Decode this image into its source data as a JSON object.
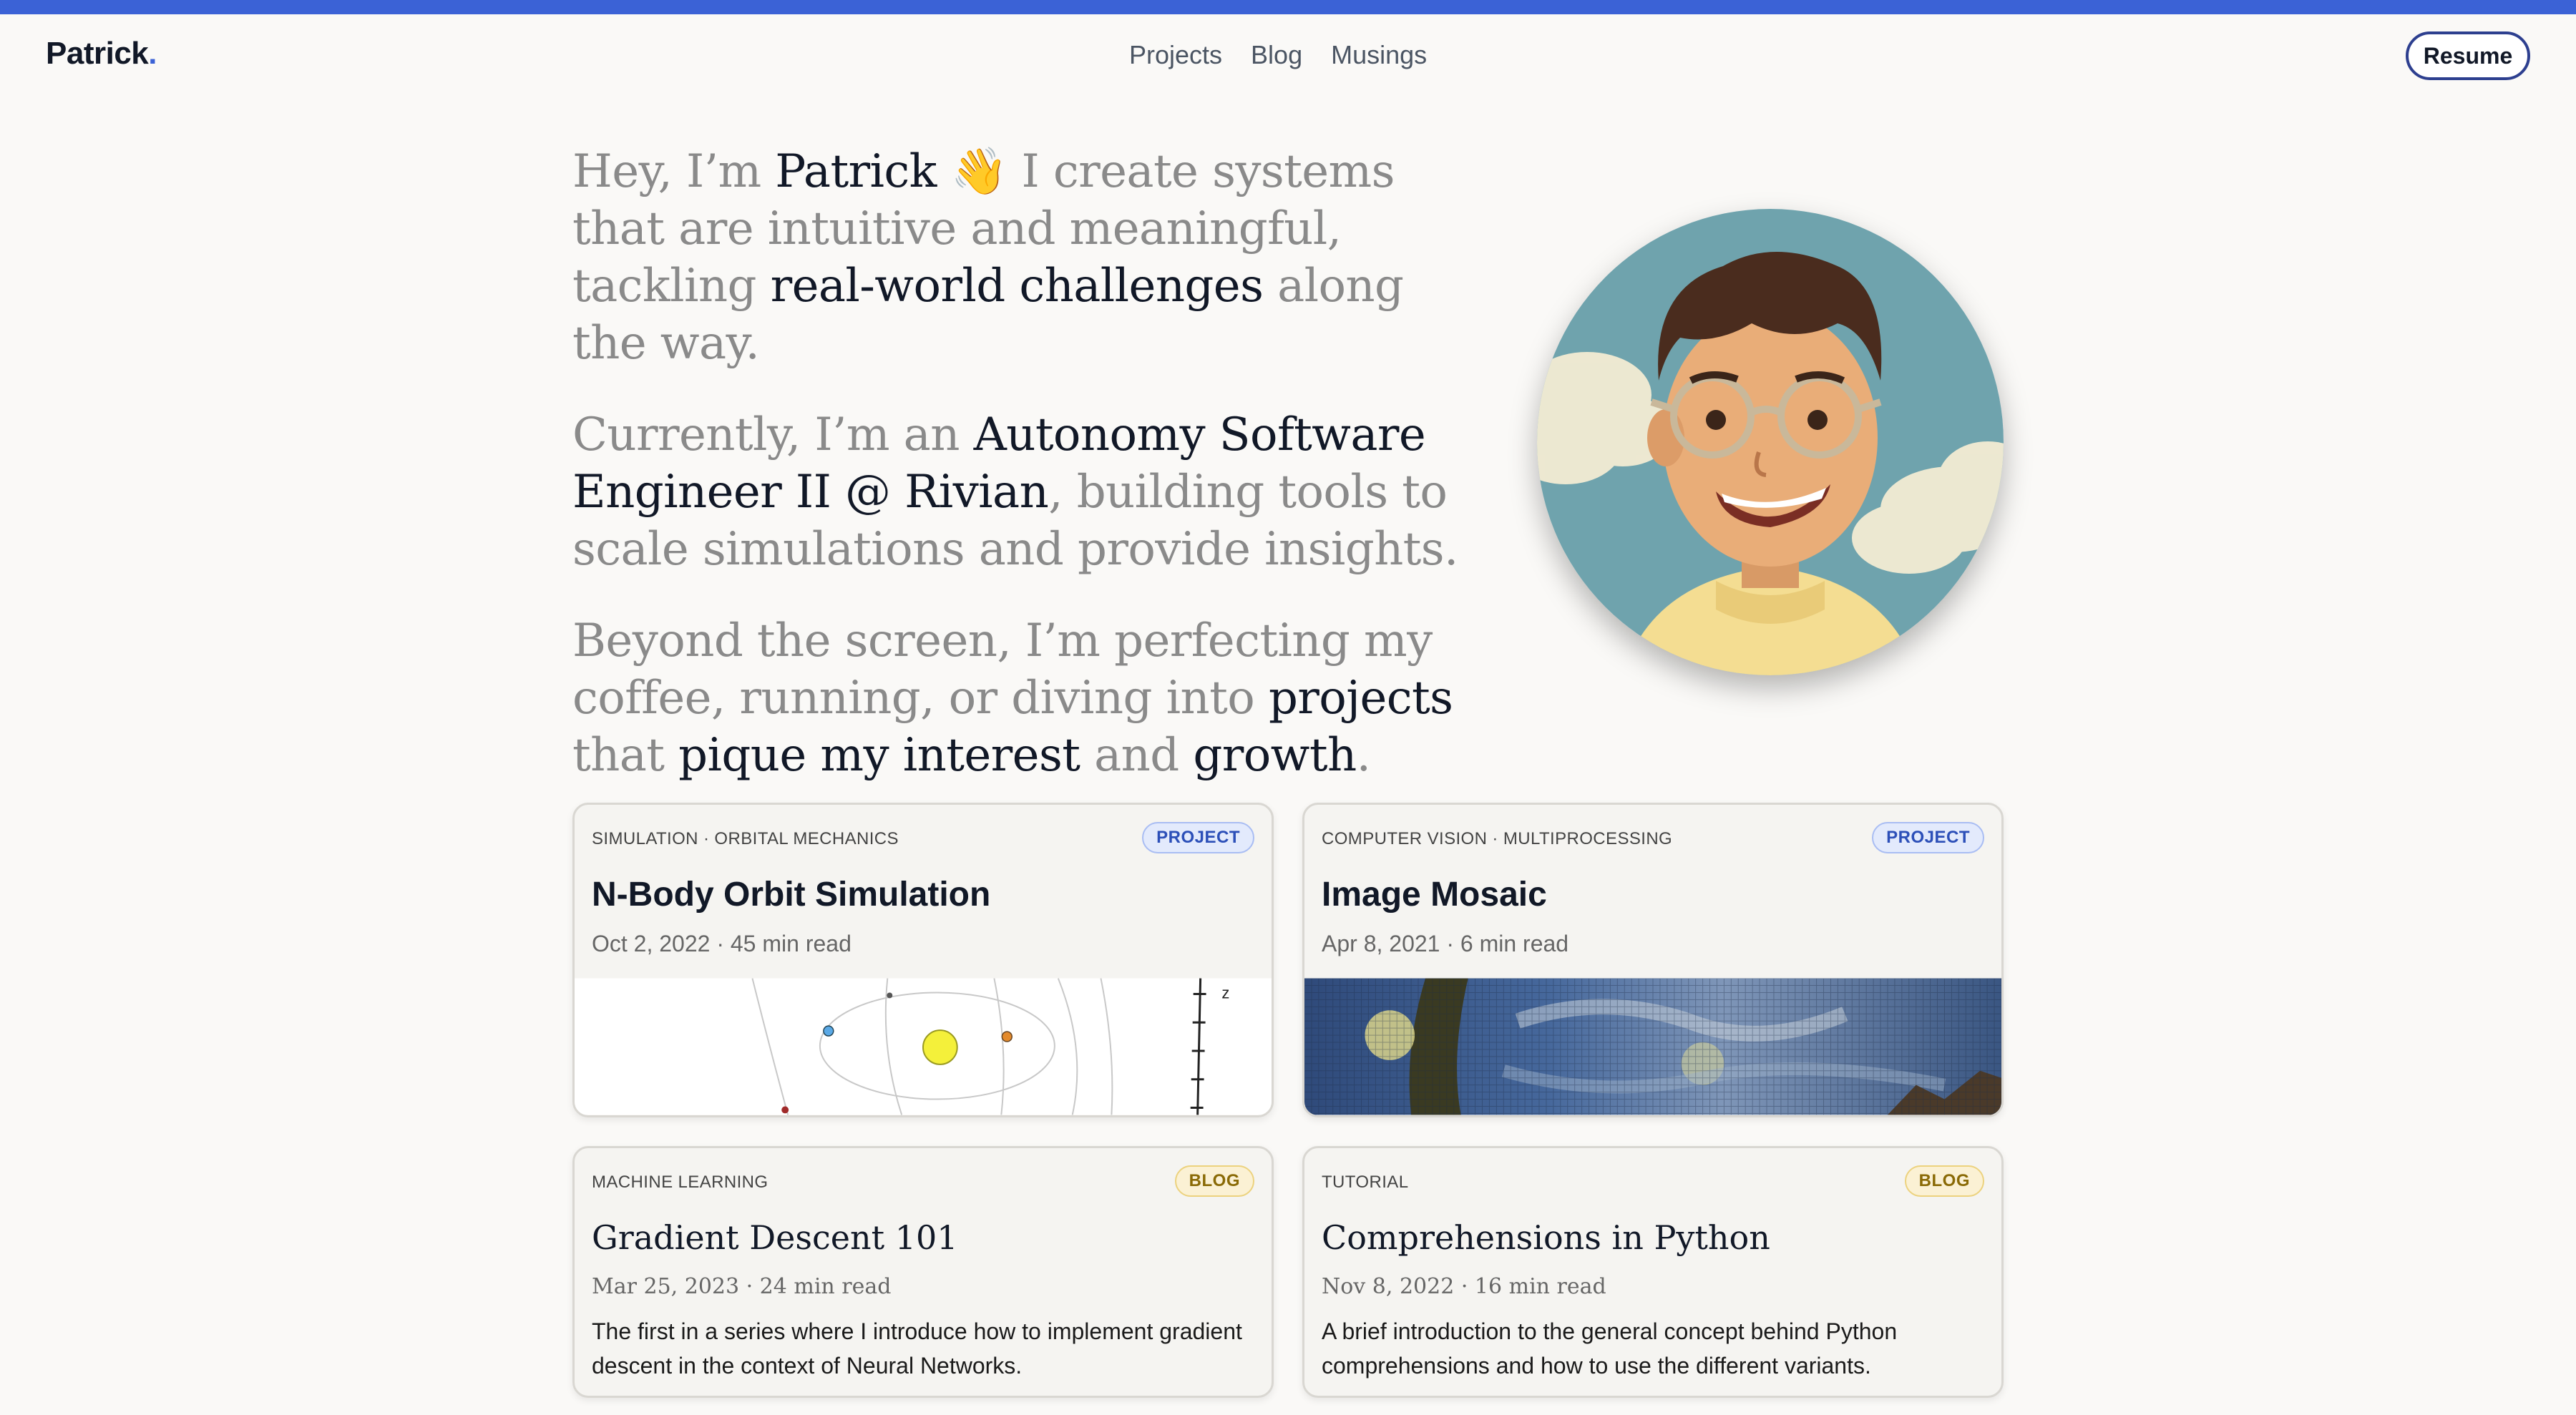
{
  "header": {
    "logo_text": "Patrick",
    "logo_dot": ".",
    "nav": [
      "Projects",
      "Blog",
      "Musings"
    ],
    "resume_label": "Resume"
  },
  "intro": {
    "p1": {
      "a": "Hey, I’m ",
      "name": "Patrick",
      "emoji": "👋",
      "b": " I create systems that are intuitive and meaningful, tackling ",
      "em": "real-world challenges",
      "c": " along the way."
    },
    "p2": {
      "a": "Currently, I’m an ",
      "em": "Autonomy Software Engineer II @ Rivian",
      "b": ", building tools to scale simulations and provide insights."
    },
    "p3": {
      "a": "Beyond the screen, I’m perfecting my coffee, running, or diving into ",
      "em1": "projects",
      "b": " that ",
      "em2": "pique my interest",
      "c": " and ",
      "em3": "growth",
      "d": "."
    }
  },
  "avatar": {
    "alt": "cartoon-portrait"
  },
  "cards": [
    {
      "kicker": "SIMULATION · ORBITAL MECHANICS",
      "badge": "PROJECT",
      "title": "N-Body Orbit Simulation",
      "meta": "Oct 2, 2022 · 45 min read",
      "thumb_axis_label": "z"
    },
    {
      "kicker": "COMPUTER VISION · MULTIPROCESSING",
      "badge": "PROJECT",
      "title": "Image Mosaic",
      "meta": "Apr 8, 2021 · 6 min read"
    },
    {
      "kicker": "MACHINE LEARNING",
      "badge": "BLOG",
      "title": "Gradient Descent 101",
      "meta": "Mar 25, 2023 · 24 min read",
      "desc": "The first in a series where I introduce how to implement gradient descent in the context of Neural Networks."
    },
    {
      "kicker": "TUTORIAL",
      "badge": "BLOG",
      "title": "Comprehensions in Python",
      "meta": "Nov 8, 2022 · 16 min read",
      "desc": "A brief introduction to the general concept behind Python comprehensions and how to use the different variants."
    }
  ],
  "colors": {
    "accent": "#3b62d6",
    "text": "#111827",
    "muted": "#8a8a8a",
    "background": "#faf9f7"
  }
}
